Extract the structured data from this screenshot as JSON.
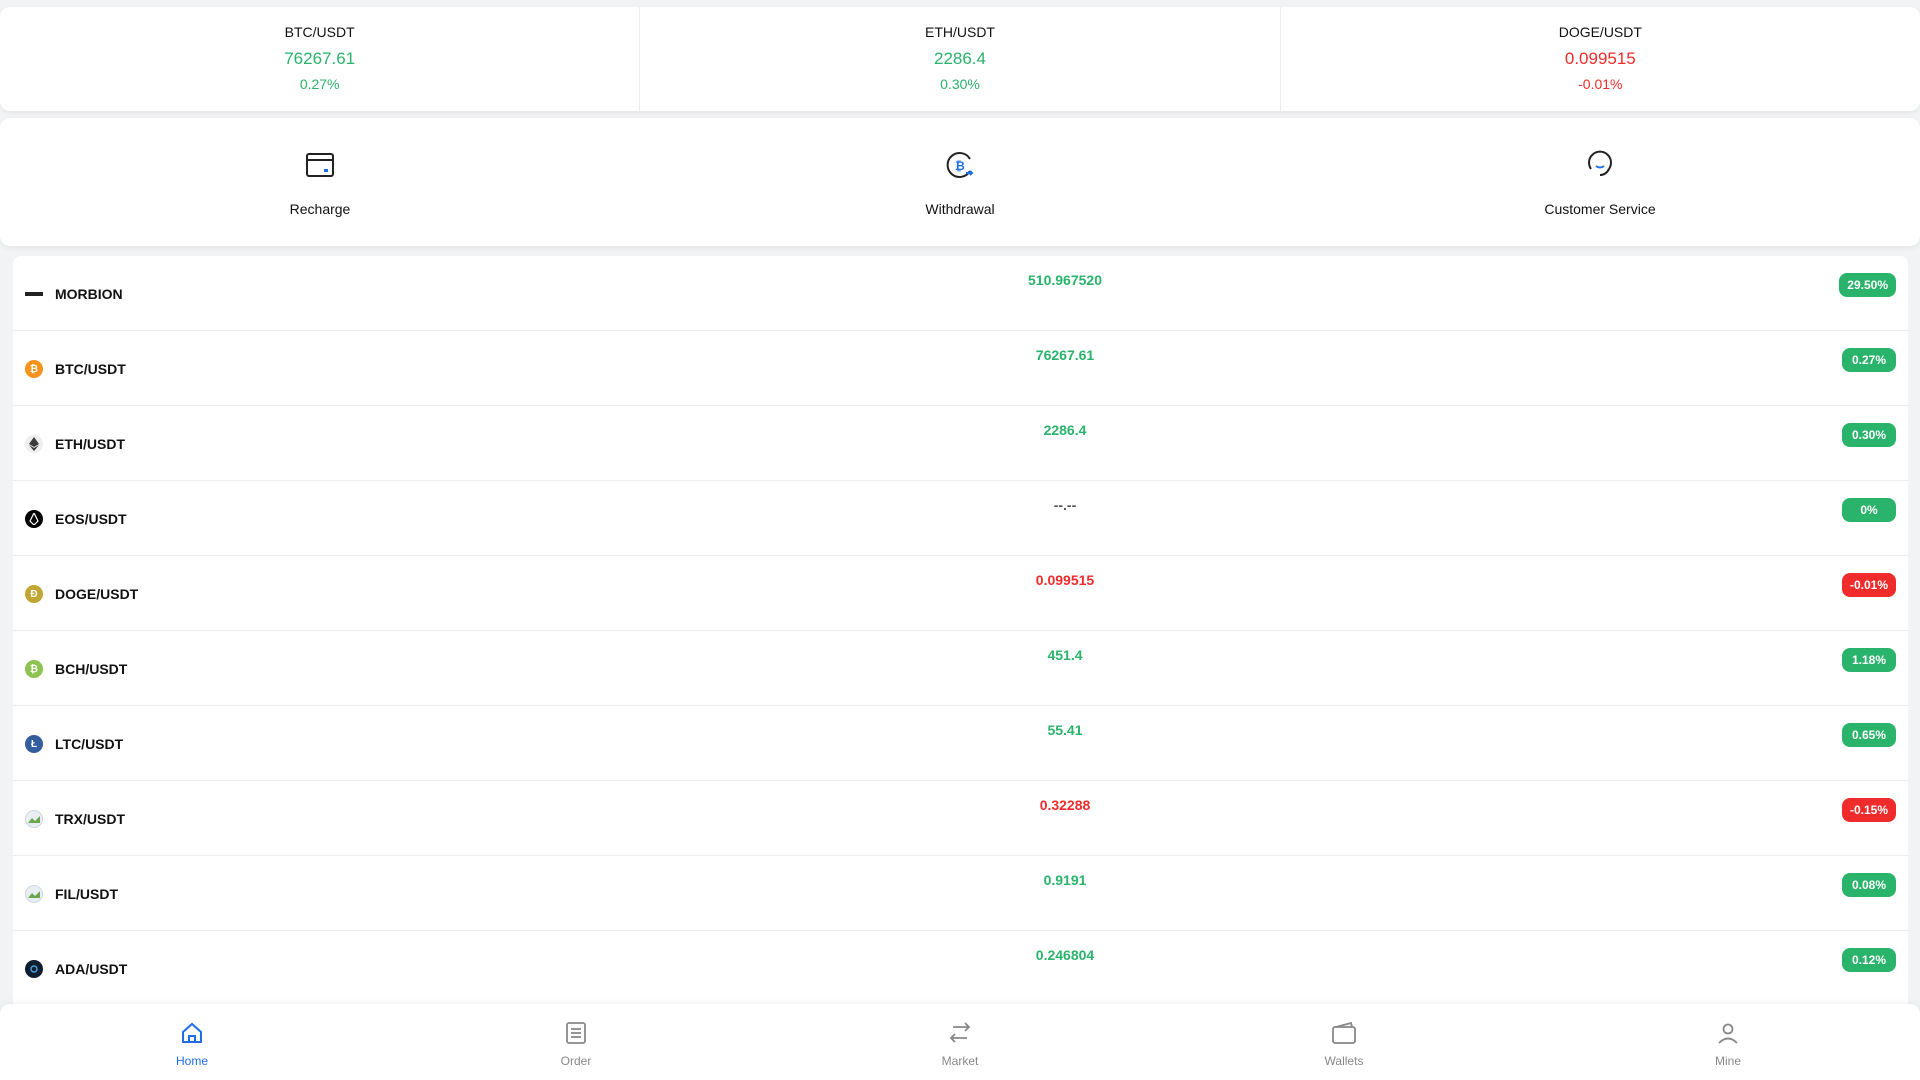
{
  "ticker": [
    {
      "pair": "BTC/USDT",
      "price": "76267.61",
      "change": "0.27%",
      "trend": "up"
    },
    {
      "pair": "ETH/USDT",
      "price": "2286.4",
      "change": "0.30%",
      "trend": "up"
    },
    {
      "pair": "DOGE/USDT",
      "price": "0.099515",
      "change": "-0.01%",
      "trend": "down"
    }
  ],
  "actions": [
    {
      "label": "Recharge",
      "icon": "card-icon"
    },
    {
      "label": "Withdrawal",
      "icon": "bitcoin-exchange-icon"
    },
    {
      "label": "Customer Service",
      "icon": "headset-icon"
    }
  ],
  "markets": [
    {
      "pair": "MORBION",
      "price": "510.967520",
      "change": "29.50%",
      "trend": "up",
      "icon": "morbion-logo-icon",
      "icon_color": "#222222"
    },
    {
      "pair": "BTC/USDT",
      "price": "76267.61",
      "change": "0.27%",
      "trend": "up",
      "icon": "bitcoin-icon",
      "icon_color": "#f7931a"
    },
    {
      "pair": "ETH/USDT",
      "price": "2286.4",
      "change": "0.30%",
      "trend": "up",
      "icon": "ethereum-icon",
      "icon_color": "#3c3c3d"
    },
    {
      "pair": "EOS/USDT",
      "price": "--.--",
      "change": "0%",
      "trend": "up",
      "icon": "eos-icon",
      "icon_color": "#000000"
    },
    {
      "pair": "DOGE/USDT",
      "price": "0.099515",
      "change": "-0.01%",
      "trend": "down",
      "icon": "dogecoin-icon",
      "icon_color": "#c2a633"
    },
    {
      "pair": "BCH/USDT",
      "price": "451.4",
      "change": "1.18%",
      "trend": "up",
      "icon": "bitcoin-cash-icon",
      "icon_color": "#8dc351"
    },
    {
      "pair": "LTC/USDT",
      "price": "55.41",
      "change": "0.65%",
      "trend": "up",
      "icon": "litecoin-icon",
      "icon_color": "#345d9d"
    },
    {
      "pair": "TRX/USDT",
      "price": "0.32288",
      "change": "-0.15%",
      "trend": "down",
      "icon": "trx-image-icon",
      "icon_color": "#a9b8c8"
    },
    {
      "pair": "FIL/USDT",
      "price": "0.9191",
      "change": "0.08%",
      "trend": "up",
      "icon": "fil-image-icon",
      "icon_color": "#a9b8c8"
    },
    {
      "pair": "ADA/USDT",
      "price": "0.246804",
      "change": "0.12%",
      "trend": "up",
      "icon": "cardano-icon",
      "icon_color": "#0d1e30"
    }
  ],
  "nav": [
    {
      "label": "Home",
      "icon": "home-icon",
      "active": true
    },
    {
      "label": "Order",
      "icon": "order-list-icon",
      "active": false
    },
    {
      "label": "Market",
      "icon": "exchange-arrows-icon",
      "active": false
    },
    {
      "label": "Wallets",
      "icon": "wallet-icon",
      "active": false
    },
    {
      "label": "Mine",
      "icon": "user-icon",
      "active": false
    }
  ],
  "colors": {
    "up": "#2ab36b",
    "down": "#ef2b2b",
    "active_nav": "#1e6fe8",
    "inactive_nav": "#888888"
  }
}
